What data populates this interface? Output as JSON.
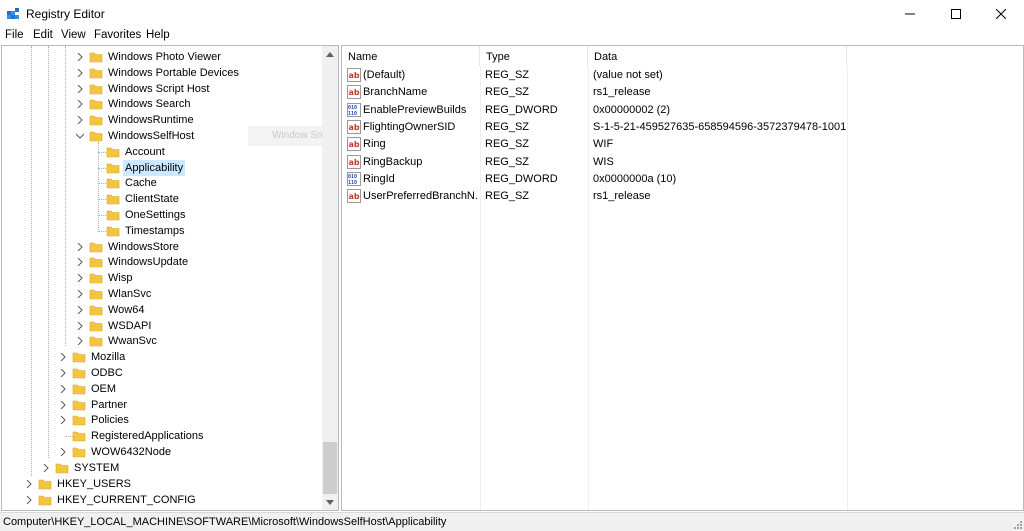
{
  "window": {
    "title": "Registry Editor"
  },
  "menu": [
    "File",
    "Edit",
    "View",
    "Favorites",
    "Help"
  ],
  "tree": [
    {
      "label": "Windows Photo Viewer",
      "expander": "collapsed"
    },
    {
      "label": "Windows Portable Devices",
      "expander": "collapsed"
    },
    {
      "label": "Windows Script Host",
      "expander": "collapsed"
    },
    {
      "label": "Windows Search",
      "expander": "collapsed"
    },
    {
      "label": "WindowsRuntime",
      "expander": "collapsed"
    },
    {
      "label": "WindowsSelfHost",
      "expander": "expanded"
    },
    {
      "label": "Account",
      "expander": "none"
    },
    {
      "label": "Applicability",
      "expander": "none",
      "selected": true
    },
    {
      "label": "Cache",
      "expander": "none"
    },
    {
      "label": "ClientState",
      "expander": "none"
    },
    {
      "label": "OneSettings",
      "expander": "none"
    },
    {
      "label": "Timestamps",
      "expander": "none"
    },
    {
      "label": "WindowsStore",
      "expander": "collapsed"
    },
    {
      "label": "WindowsUpdate",
      "expander": "collapsed"
    },
    {
      "label": "Wisp",
      "expander": "collapsed"
    },
    {
      "label": "WlanSvc",
      "expander": "collapsed"
    },
    {
      "label": "Wow64",
      "expander": "collapsed"
    },
    {
      "label": "WSDAPI",
      "expander": "collapsed"
    },
    {
      "label": "WwanSvc",
      "expander": "collapsed"
    },
    {
      "label": "Mozilla",
      "expander": "collapsed"
    },
    {
      "label": "ODBC",
      "expander": "collapsed"
    },
    {
      "label": "OEM",
      "expander": "collapsed"
    },
    {
      "label": "Partner",
      "expander": "collapsed"
    },
    {
      "label": "Policies",
      "expander": "collapsed"
    },
    {
      "label": "RegisteredApplications",
      "expander": "none"
    },
    {
      "label": "WOW6432Node",
      "expander": "collapsed"
    },
    {
      "label": "SYSTEM",
      "expander": "collapsed"
    },
    {
      "label": "HKEY_USERS",
      "expander": "collapsed"
    },
    {
      "label": "HKEY_CURRENT_CONFIG",
      "expander": "collapsed"
    }
  ],
  "drag_ghost": "Window Sna",
  "list": {
    "columns": [
      "Name",
      "Type",
      "Data"
    ],
    "rows": [
      {
        "icon": "string-value-icon",
        "name": "(Default)",
        "type": "REG_SZ",
        "data": "(value not set)"
      },
      {
        "icon": "string-value-icon",
        "name": "BranchName",
        "type": "REG_SZ",
        "data": "rs1_release"
      },
      {
        "icon": "dword-value-icon",
        "name": "EnablePreviewBuilds",
        "type": "REG_DWORD",
        "data": "0x00000002 (2)"
      },
      {
        "icon": "string-value-icon",
        "name": "FlightingOwnerSID",
        "type": "REG_SZ",
        "data": "S-1-5-21-459527635-658594596-3572379478-1001"
      },
      {
        "icon": "string-value-icon",
        "name": "Ring",
        "type": "REG_SZ",
        "data": "WIF"
      },
      {
        "icon": "string-value-icon",
        "name": "RingBackup",
        "type": "REG_SZ",
        "data": "WIS"
      },
      {
        "icon": "dword-value-icon",
        "name": "RingId",
        "type": "REG_DWORD",
        "data": "0x0000000a (10)"
      },
      {
        "icon": "string-value-icon",
        "name": "UserPreferredBranchN...",
        "type": "REG_SZ",
        "data": "rs1_release"
      }
    ]
  },
  "status": "Computer\\HKEY_LOCAL_MACHINE\\SOFTWARE\\Microsoft\\WindowsSelfHost\\Applicability",
  "colors": {
    "selection": "#cce8ff",
    "folder": "#f4c542",
    "string_icon": "#c0392b",
    "dword_icon": "#1f4fa8"
  }
}
